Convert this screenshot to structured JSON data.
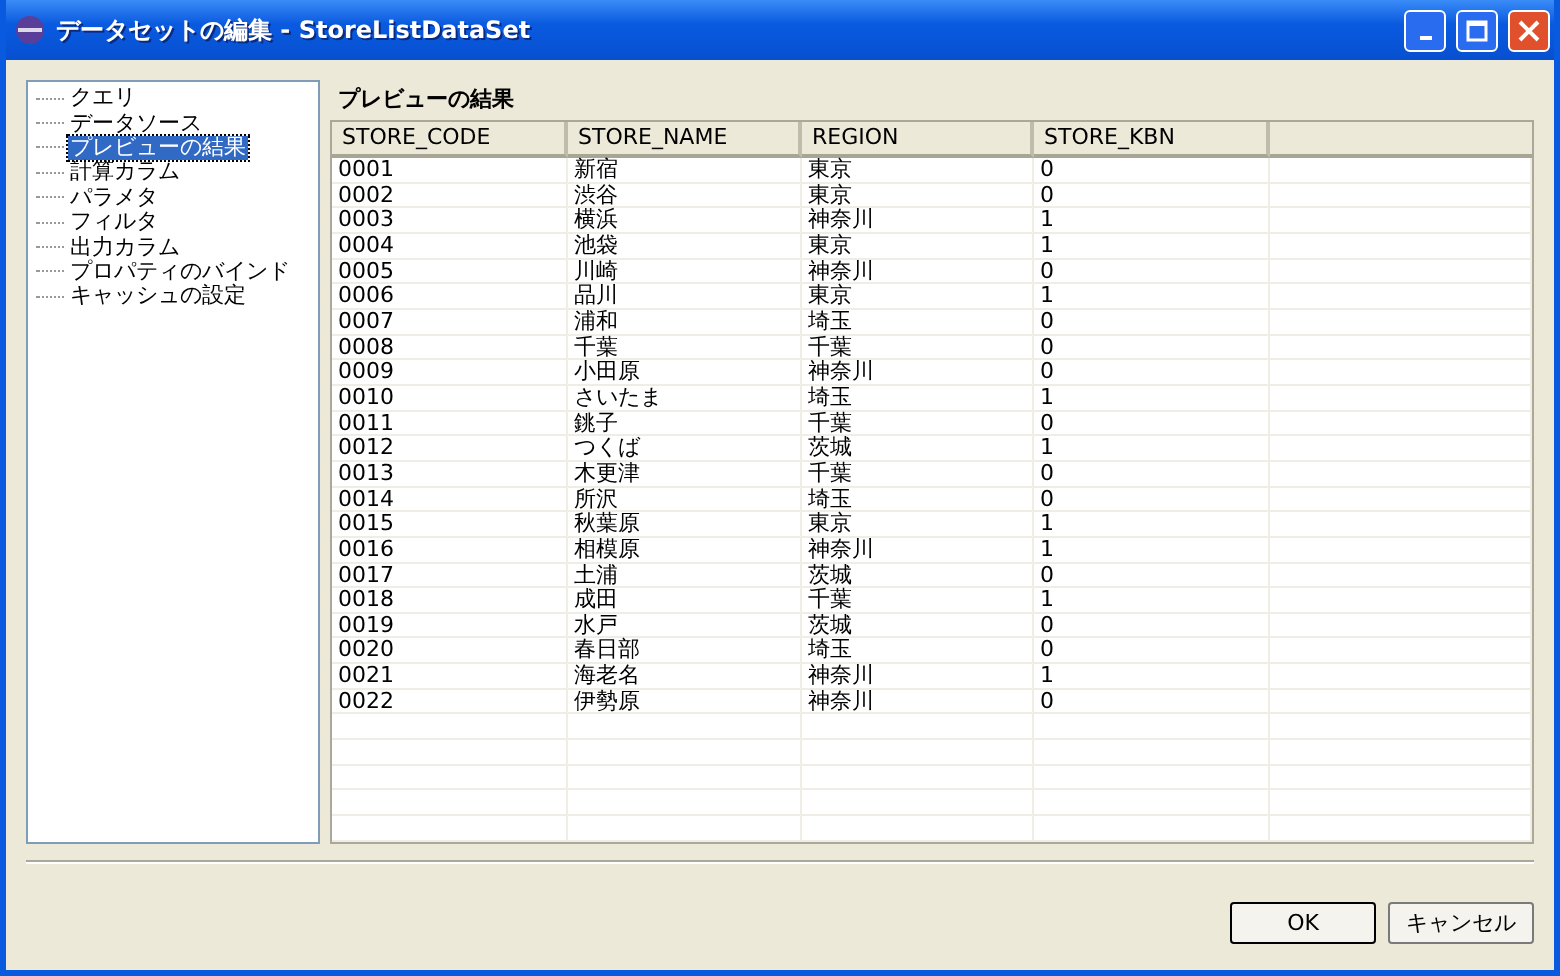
{
  "window": {
    "title": "データセットの編集 - StoreListDataSet"
  },
  "sidebar": {
    "items": [
      {
        "label": "クエリ",
        "selected": false
      },
      {
        "label": "データソース",
        "selected": false
      },
      {
        "label": "プレビューの結果",
        "selected": true
      },
      {
        "label": "計算カラム",
        "selected": false
      },
      {
        "label": "パラメタ",
        "selected": false
      },
      {
        "label": "フィルタ",
        "selected": false
      },
      {
        "label": "出力カラム",
        "selected": false
      },
      {
        "label": "プロパティのバインド",
        "selected": false
      },
      {
        "label": "キャッシュの設定",
        "selected": false
      }
    ]
  },
  "panel": {
    "title": "プレビューの結果"
  },
  "table": {
    "columns": [
      "STORE_CODE",
      "STORE_NAME",
      "REGION",
      "STORE_KBN"
    ],
    "rows": [
      [
        "0001",
        "新宿",
        "東京",
        "0"
      ],
      [
        "0002",
        "渋谷",
        "東京",
        "0"
      ],
      [
        "0003",
        "横浜",
        "神奈川",
        "1"
      ],
      [
        "0004",
        "池袋",
        "東京",
        "1"
      ],
      [
        "0005",
        "川崎",
        "神奈川",
        "0"
      ],
      [
        "0006",
        "品川",
        "東京",
        "1"
      ],
      [
        "0007",
        "浦和",
        "埼玉",
        "0"
      ],
      [
        "0008",
        "千葉",
        "千葉",
        "0"
      ],
      [
        "0009",
        "小田原",
        "神奈川",
        "0"
      ],
      [
        "0010",
        "さいたま",
        "埼玉",
        "1"
      ],
      [
        "0011",
        "銚子",
        "千葉",
        "0"
      ],
      [
        "0012",
        "つくば",
        "茨城",
        "1"
      ],
      [
        "0013",
        "木更津",
        "千葉",
        "0"
      ],
      [
        "0014",
        "所沢",
        "埼玉",
        "0"
      ],
      [
        "0015",
        "秋葉原",
        "東京",
        "1"
      ],
      [
        "0016",
        "相模原",
        "神奈川",
        "1"
      ],
      [
        "0017",
        "土浦",
        "茨城",
        "0"
      ],
      [
        "0018",
        "成田",
        "千葉",
        "1"
      ],
      [
        "0019",
        "水戸",
        "茨城",
        "0"
      ],
      [
        "0020",
        "春日部",
        "埼玉",
        "0"
      ],
      [
        "0021",
        "海老名",
        "神奈川",
        "1"
      ],
      [
        "0022",
        "伊勢原",
        "神奈川",
        "0"
      ]
    ]
  },
  "buttons": [
    "OK",
    "キャンセル"
  ]
}
